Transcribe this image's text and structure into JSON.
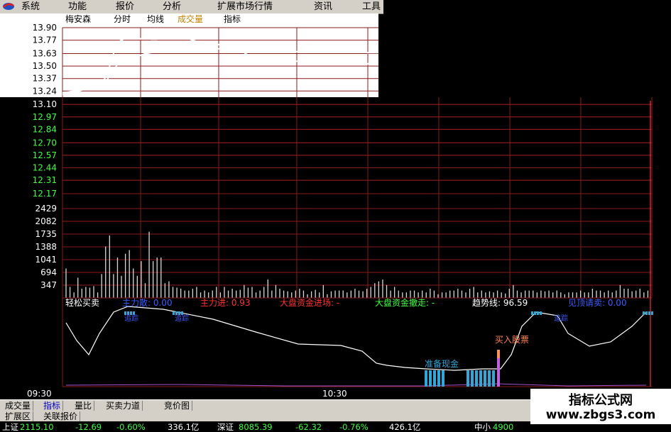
{
  "menu": [
    "系统",
    "功能",
    "报价",
    "分析",
    "扩展市场行情",
    "资讯",
    "工具"
  ],
  "chart_header": {
    "stock_name": "梅安森",
    "items": [
      "分时",
      "均线",
      "成交量",
      "指标"
    ]
  },
  "chart_data": [
    {
      "type": "line",
      "name": "price",
      "yticks": [
        "13.90",
        "13.77",
        "13.63",
        "13.50",
        "13.37",
        "13.24",
        "13.10",
        "12.97",
        "12.84",
        "12.70",
        "12.57",
        "12.44",
        "12.31",
        "12.17"
      ],
      "x_labels": [
        "09:30",
        "10:30"
      ],
      "series": [
        {
          "name": "分时",
          "values": [
            13.2,
            13.22,
            13.24,
            13.24,
            13.26,
            13.28,
            13.28,
            13.32,
            13.4,
            13.6,
            13.75,
            13.78,
            13.8,
            13.8,
            13.78,
            13.82,
            13.78,
            13.78,
            13.87,
            13.89,
            13.86,
            13.82,
            13.8,
            13.78,
            13.76,
            13.72,
            13.72,
            13.74,
            13.72,
            13.74,
            13.72,
            13.7,
            13.68,
            13.63,
            13.6,
            13.52,
            13.54,
            13.6,
            13.6,
            13.58,
            13.57,
            13.54,
            13.55,
            13.55,
            13.58,
            13.56,
            13.55,
            13.54,
            13.56,
            13.58,
            13.58,
            13.57,
            13.6,
            13.58,
            13.57,
            13.52,
            13.56,
            13.55
          ]
        },
        {
          "name": "均线",
          "values": [
            13.22,
            13.23,
            13.24,
            13.25,
            13.26,
            13.27,
            13.28,
            13.3,
            13.35,
            13.45,
            13.52,
            13.55,
            13.57,
            13.59,
            13.61,
            13.63,
            13.64,
            13.65,
            13.66,
            13.67,
            13.67,
            13.68,
            13.68,
            13.68,
            13.68,
            13.68,
            13.68,
            13.68,
            13.68,
            13.68,
            13.68,
            13.68,
            13.68,
            13.67,
            13.67,
            13.66,
            13.66,
            13.66,
            13.66,
            13.66,
            13.66,
            13.65,
            13.65,
            13.65,
            13.65,
            13.65,
            13.65,
            13.65,
            13.65,
            13.65,
            13.65,
            13.65,
            13.65,
            13.65,
            13.65,
            13.64,
            13.64,
            13.64
          ]
        }
      ]
    },
    {
      "type": "bar",
      "name": "volume",
      "yticks": [
        "2429",
        "2082",
        "1735",
        "1388",
        "1041",
        "694",
        "347"
      ],
      "values": [
        800,
        300,
        150,
        550,
        250,
        300,
        280,
        320,
        150,
        650,
        1400,
        1700,
        650,
        1100,
        600,
        1200,
        1300,
        800,
        600,
        1000,
        400,
        1800,
        1000,
        1100,
        1100,
        400,
        450,
        300,
        280,
        250,
        200,
        200,
        250,
        300,
        150,
        200,
        150,
        200,
        300,
        150,
        300,
        200,
        250,
        200,
        220,
        350,
        280,
        300,
        150,
        200,
        300,
        500,
        200,
        350,
        250,
        200,
        180,
        150,
        200,
        250,
        200,
        100,
        180,
        220,
        150,
        350,
        100,
        180,
        200,
        200,
        200,
        150,
        200,
        250,
        200,
        180,
        250,
        300,
        400,
        450,
        500,
        350,
        200,
        300,
        200,
        150,
        150,
        200,
        200,
        150,
        200,
        150,
        250,
        200,
        100,
        150,
        150,
        200,
        200,
        250,
        200,
        150,
        250,
        300,
        150,
        200,
        150,
        180,
        150,
        200,
        150,
        120,
        250,
        350,
        200,
        150,
        200,
        200,
        200,
        150,
        200,
        180,
        200,
        150,
        200,
        150,
        100,
        150,
        150,
        150,
        200,
        150,
        150,
        250,
        200,
        200,
        150,
        200,
        150,
        200,
        350,
        250,
        250,
        180,
        200,
        250,
        150,
        200
      ]
    },
    {
      "type": "line",
      "name": "indicator",
      "title": "轻松买卖",
      "legend": [
        {
          "label": "主力散",
          "value": "0.00",
          "color": "#3a5cff"
        },
        {
          "label": "主力进",
          "value": "0.93",
          "color": "#ff3030"
        },
        {
          "label": "大盘资金进场",
          "value": "-",
          "color": "#ff3030"
        },
        {
          "label": "大盘资金撤走",
          "value": "-",
          "color": "#40ff40"
        },
        {
          "label": "趋势线",
          "value": "96.59",
          "color": "#ffffff"
        },
        {
          "label": "见顶请卖",
          "value": "0.00",
          "color": "#3a5cff"
        }
      ],
      "annotations": [
        "准备现金",
        "买入股票"
      ],
      "small_labels": [
        "追踪",
        "追踪",
        "追踪"
      ]
    }
  ],
  "tabs": [
    "成交量",
    "指标",
    "量比",
    "买卖力道",
    "竞价图"
  ],
  "tabs2": [
    "扩展区",
    "关联报价"
  ],
  "status": {
    "sh_label": "上证",
    "sh_value": "2115.10",
    "sh_change": "-12.69",
    "sh_pct": "-0.60%",
    "sh_amount": "336.1亿",
    "sz_label": "深证",
    "sz_value": "8085.39",
    "sz_change": "-62.32",
    "sz_pct": "-0.76%",
    "sz_amount": "426.1亿",
    "zx_label": "中小",
    "zx_value": "4900"
  },
  "watermark": {
    "line1": "指标公式网",
    "line2": "www.zbgs3.com"
  },
  "colors": {
    "grid": "#8b1a1a",
    "price_up": "#ff4040",
    "price_down": "#40ff40",
    "white": "#ffffff",
    "blue": "#3a5cff",
    "cyan": "#33a6d8"
  }
}
